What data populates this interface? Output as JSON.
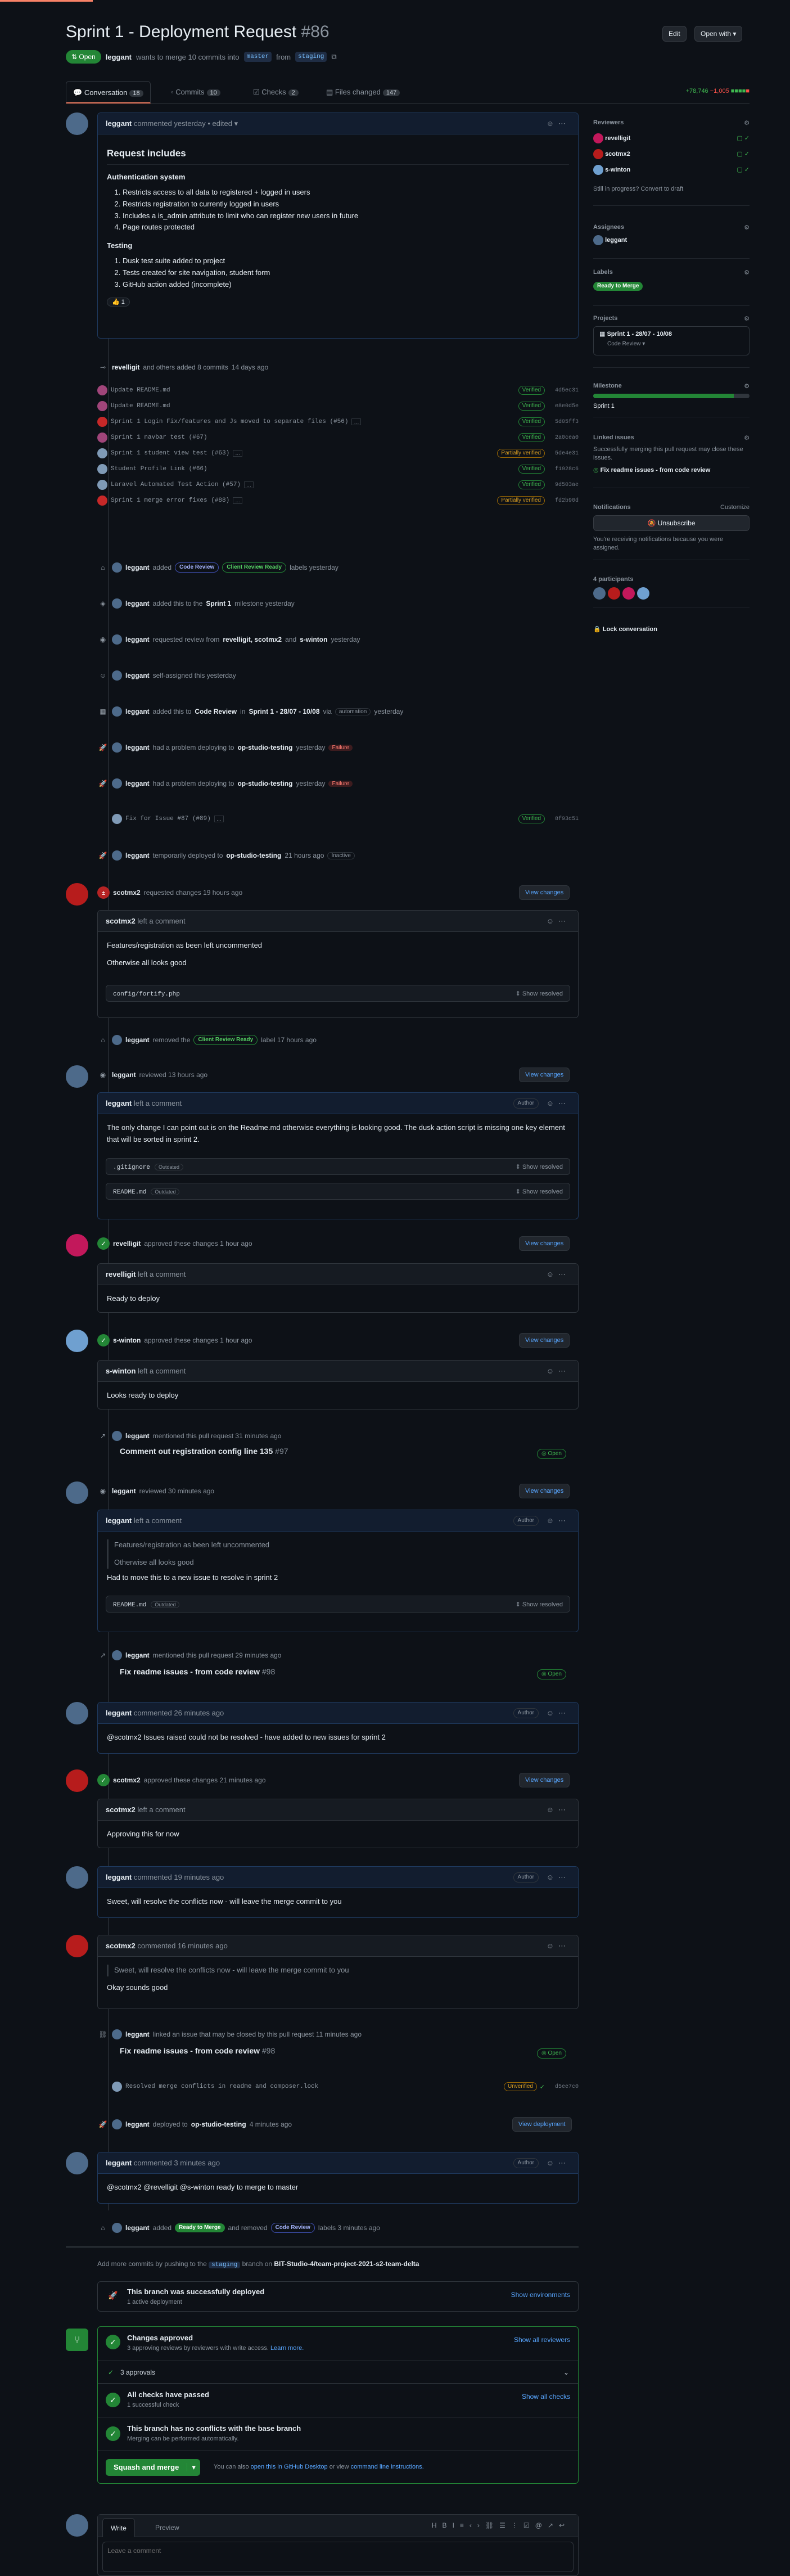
{
  "pr": {
    "title": "Sprint 1 - Deployment Request",
    "number": "#86",
    "state": "Open",
    "author": "leggant",
    "summary": "wants to merge 10 commits into",
    "base": "master",
    "from": "from",
    "head": "staging",
    "edit": "Edit",
    "open_with": "Open with"
  },
  "tabs": [
    {
      "label": "Conversation",
      "count": "18"
    },
    {
      "label": "Commits",
      "count": "10"
    },
    {
      "label": "Checks",
      "count": "2"
    },
    {
      "label": "Files changed",
      "count": "147"
    }
  ],
  "diffstat": {
    "add": "+78,746",
    "del": "−1,005"
  },
  "opening": {
    "author": "leggant",
    "meta": "commented yesterday • edited",
    "heading": "Request includes",
    "h2a": "Authentication system",
    "list1": [
      "Restricts access to all data to registered + logged in users",
      "Restricts registration to currently logged in users",
      "Includes a is_admin attribute to limit who can register new users in future",
      "Page routes protected"
    ],
    "h2b": "Testing",
    "list2": [
      "Dusk test suite added to project",
      "Tests created for site navigation, student form",
      "GitHub action added (incomplete)"
    ],
    "reaction": "1"
  },
  "commits_ev": {
    "who": "revelligit",
    "text": "and others added 8 commits",
    "when": "14 days ago"
  },
  "commits": [
    {
      "msg": "Update README.md",
      "badge": "Verified",
      "sha": "4d5ec31"
    },
    {
      "msg": "Update README.md",
      "badge": "Verified",
      "sha": "e8e0d5e"
    },
    {
      "msg": "Sprint 1 Login Fix/features and Js moved to separate files (#56)",
      "badge": "Verified",
      "sha": "5d05ff3"
    },
    {
      "msg": "Sprint 1 navbar test (#67)",
      "badge": "Verified",
      "sha": "2a0cea0"
    },
    {
      "msg": "Sprint 1 student view test (#63)",
      "badge": "Partially verified",
      "sha": "5de4e31"
    },
    {
      "msg": "Student Profile Link (#66)",
      "badge": "Verified",
      "sha": "f1928c6"
    },
    {
      "msg": "Laravel Automated Test Action (#57)",
      "badge": "Verified",
      "sha": "9d503ae"
    },
    {
      "msg": "Sprint 1 merge error fixes (#88)",
      "badge": "Partially verified",
      "sha": "fd2b90d"
    }
  ],
  "events1": [
    {
      "who": "leggant",
      "text": "added",
      "l1": "Code Review",
      "l2": "Client Review Ready",
      "tail": "labels yesterday"
    },
    {
      "who": "leggant",
      "text": "added this to the",
      "bold": "Sprint 1",
      "tail": "milestone yesterday"
    },
    {
      "who": "leggant",
      "text": "requested review from",
      "bold": "revelligit, scotmx2",
      "mid": "and",
      "bold2": "s-winton",
      "tail": "yesterday"
    },
    {
      "who": "leggant",
      "text": "self-assigned this yesterday"
    },
    {
      "who": "leggant",
      "text": "added this to",
      "bold": "Code Review",
      "mid": "in",
      "bold2": "Sprint 1 - 28/07 - 10/08",
      "tail": "via",
      "chip": "automation",
      "tail2": "yesterday"
    },
    {
      "who": "leggant",
      "text": "had a problem deploying to",
      "bold": "op-studio-testing",
      "tail": "yesterday",
      "fail": "Failure"
    },
    {
      "who": "leggant",
      "text": "had a problem deploying to",
      "bold": "op-studio-testing",
      "tail": "yesterday",
      "fail": "Failure"
    }
  ],
  "commit_fix": {
    "msg": "Fix for Issue #87 (#89)",
    "badge": "Verified",
    "sha": "8f93c51"
  },
  "deploy_temp": {
    "who": "leggant",
    "text": "temporarily deployed to",
    "bold": "op-studio-testing",
    "tail": "21 hours ago",
    "chip": "Inactive"
  },
  "review1": {
    "who": "scotmx2",
    "text": "requested changes 19 hours ago",
    "btn": "View changes",
    "cwho": "scotmx2",
    "ctext": "left a comment",
    "p1": "Features/registration as been left uncommented",
    "p2": "Otherwise all looks good",
    "file": "config/fortify.php",
    "show": "Show resolved"
  },
  "remove_label": {
    "who": "leggant",
    "text": "removed the",
    "label": "Client Review Ready",
    "tail": "label 17 hours ago"
  },
  "review2": {
    "who": "leggant",
    "text": "reviewed 13 hours ago",
    "btn": "View changes",
    "cwho": "leggant",
    "ctext": "left a comment",
    "author": "Author",
    "p1": "The only change I can point out is on the Readme.md otherwise everything is looking good. The dusk action script is missing one key element that will be sorted in sprint 2.",
    "f1": ".gitignore",
    "f2": "README.md",
    "outd": "Outdated",
    "show": "Show resolved"
  },
  "approve1": {
    "who": "revelligit",
    "text": "approved these changes 1 hour ago",
    "btn": "View changes",
    "cwho": "revelligit",
    "ctext": "left a comment",
    "p": "Ready to deploy"
  },
  "approve2": {
    "who": "s-winton",
    "text": "approved these changes 1 hour ago",
    "btn": "View changes",
    "cwho": "s-winton",
    "ctext": "left a comment",
    "p": "Looks ready to deploy"
  },
  "mention1": {
    "who": "leggant",
    "text": "mentioned this pull request 31 minutes ago",
    "title": "Comment out registration config line 135",
    "num": "#97",
    "state": "Open"
  },
  "review3": {
    "who": "leggant",
    "text": "reviewed 30 minutes ago",
    "btn": "View changes",
    "cwho": "leggant",
    "ctext": "left a comment",
    "author": "Author",
    "q1": "Features/registration as been left uncommented",
    "q2": "Otherwise all looks good",
    "p": "Had to move this to a new issue to resolve in sprint 2",
    "file": "README.md",
    "outd": "Outdated",
    "show": "Show resolved"
  },
  "mention2": {
    "who": "leggant",
    "text": "mentioned this pull request 29 minutes ago",
    "title": "Fix readme issues - from code review",
    "num": "#98",
    "state": "Open"
  },
  "comment1": {
    "who": "leggant",
    "text": "commented 26 minutes ago",
    "author": "Author",
    "p": "@scotmx2 Issues raised could not be resolved - have added to new issues for sprint 2"
  },
  "approve3": {
    "who": "scotmx2",
    "text": "approved these changes 21 minutes ago",
    "btn": "View changes",
    "cwho": "scotmx2",
    "ctext": "left a comment",
    "p": "Approving this for now"
  },
  "comment2": {
    "who": "leggant",
    "text": "commented 19 minutes ago",
    "author": "Author",
    "p": "Sweet, will resolve the conflicts now - will leave the merge commit to you"
  },
  "comment3": {
    "who": "scotmx2",
    "text": "commented 16 minutes ago",
    "q": "Sweet, will resolve the conflicts now - will leave the merge commit to you",
    "p": "Okay sounds good"
  },
  "linked": {
    "who": "leggant",
    "text": "linked an issue that may be closed by this pull request 11 minutes ago",
    "title": "Fix readme issues - from code review",
    "num": "#98",
    "state": "Open"
  },
  "commit_resolve": {
    "msg": "Resolved merge conflicts in readme and composer.lock",
    "badge": "Unverified",
    "sha": "d5ee7c0"
  },
  "deploy2": {
    "who": "leggant",
    "text": "deployed to",
    "bold": "op-studio-testing",
    "tail": "4 minutes ago",
    "btn": "View deployment"
  },
  "comment4": {
    "who": "leggant",
    "text": "commented 3 minutes ago",
    "author": "Author",
    "p": "@scotmx2 @revelligit @s-winton ready to merge to master"
  },
  "final_labels": {
    "who": "leggant",
    "text": "added",
    "l1": "Ready to Merge",
    "mid": "and removed",
    "l2": "Code Review",
    "tail": "labels 3 minutes ago"
  },
  "push_note": {
    "pre": "Add more commits by pushing to the",
    "branch": "staging",
    "mid": "branch on",
    "repo": "BIT-Studio-4/team-project-2021-s2-team-delta"
  },
  "deployed": {
    "title": "This branch was successfully deployed",
    "sub": "1 active deployment",
    "btn": "Show environments"
  },
  "merge": {
    "approved_title": "Changes approved",
    "approved_sub": "3 approving reviews by reviewers with write access.",
    "learn": "Learn more.",
    "show_rev": "Show all reviewers",
    "approvals": "3 approvals",
    "checks_title": "All checks have passed",
    "checks_sub": "1 successful check",
    "show_checks": "Show all checks",
    "conf_title": "This branch has no conflicts with the base branch",
    "conf_sub": "Merging can be performed automatically.",
    "merge_btn": "Squash and merge",
    "also": "You can also",
    "desktop": "open this in GitHub Desktop",
    "or": "or view",
    "cli": "command line instructions."
  },
  "editor": {
    "write": "Write",
    "preview": "Preview",
    "placeholder": "Leave a comment"
  },
  "sidebar": {
    "reviewers": "Reviewers",
    "rev": [
      "revelligit",
      "scotmx2",
      "s-winton"
    ],
    "draft": "Still in progress? Convert to draft",
    "assignees": "Assignees",
    "assignee": "leggant",
    "labels": "Labels",
    "label": "Ready to Merge",
    "projects": "Projects",
    "project": "Sprint 1 - 28/07 - 10/08",
    "project_col": "Code Review",
    "milestone": "Milestone",
    "milestone_name": "Sprint 1",
    "milestone_pct": 0.9,
    "linked": "Linked issues",
    "linked_sub": "Successfully merging this pull request may close these issues.",
    "linked_issue": "Fix readme issues - from code review",
    "notif": "Notifications",
    "customize": "Customize",
    "unsub": "Unsubscribe",
    "notif_sub": "You're receiving notifications because you were assigned.",
    "participants": "4 participants",
    "lock": "Lock conversation"
  },
  "colors": {
    "accent": "#58a6ff",
    "green": "#238636",
    "red": "#f85149",
    "bg": "#0d1117"
  }
}
